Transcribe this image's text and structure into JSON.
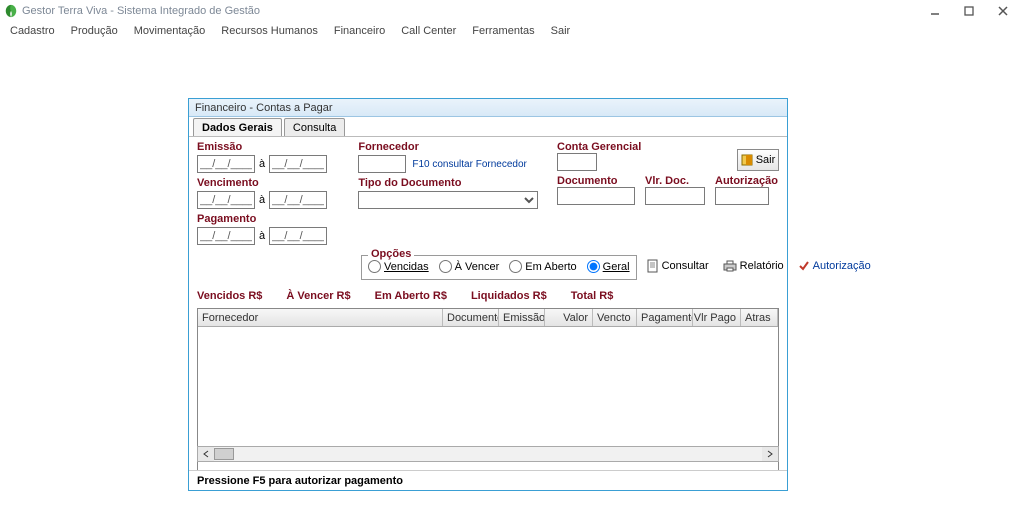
{
  "app": {
    "title": "Gestor Terra Viva - Sistema Integrado de Gestão"
  },
  "mainmenu": [
    "Cadastro",
    "Produção",
    "Movimentação",
    "Recursos Humanos",
    "Financeiro",
    "Call Center",
    "Ferramentas",
    "Sair"
  ],
  "window": {
    "title": "Financeiro - Contas a Pagar",
    "tabs": {
      "dados": "Dados Gerais",
      "consulta": "Consulta"
    },
    "labels": {
      "emissao": "Emissão",
      "vencimento": "Vencimento",
      "pagamento": "Pagamento",
      "fornecedor": "Fornecedor",
      "tipo_doc": "Tipo do Documento",
      "conta_gerencial": "Conta Gerencial",
      "documento": "Documento",
      "vlr_doc": "Vlr. Doc.",
      "autorizacao": "Autorização",
      "a": "à"
    },
    "hint_f10": "F10 consultar Fornecedor",
    "date_mask": "__/__/____",
    "opcoes": {
      "legend": "Opções",
      "vencidas": "Vencidas",
      "avencer": "À Vencer",
      "emaberto": "Em Aberto",
      "geral": "Geral"
    },
    "actions": {
      "consultar": "Consultar",
      "relatorio": "Relatório",
      "autorizacao": "Autorização",
      "sair": "Sair"
    },
    "totals": {
      "vencidos": "Vencidos R$",
      "avencer": "À Vencer R$",
      "emaberto": "Em Aberto R$",
      "liquidados": "Liquidados R$",
      "total": "Total R$"
    },
    "grid_headers": [
      "Fornecedor",
      "Documento",
      "Emissão",
      "Valor",
      "Vencto",
      "Pagamento",
      "Vlr Pago",
      "Atras"
    ],
    "statusbar": "Pressione F5 para autorizar pagamento"
  }
}
